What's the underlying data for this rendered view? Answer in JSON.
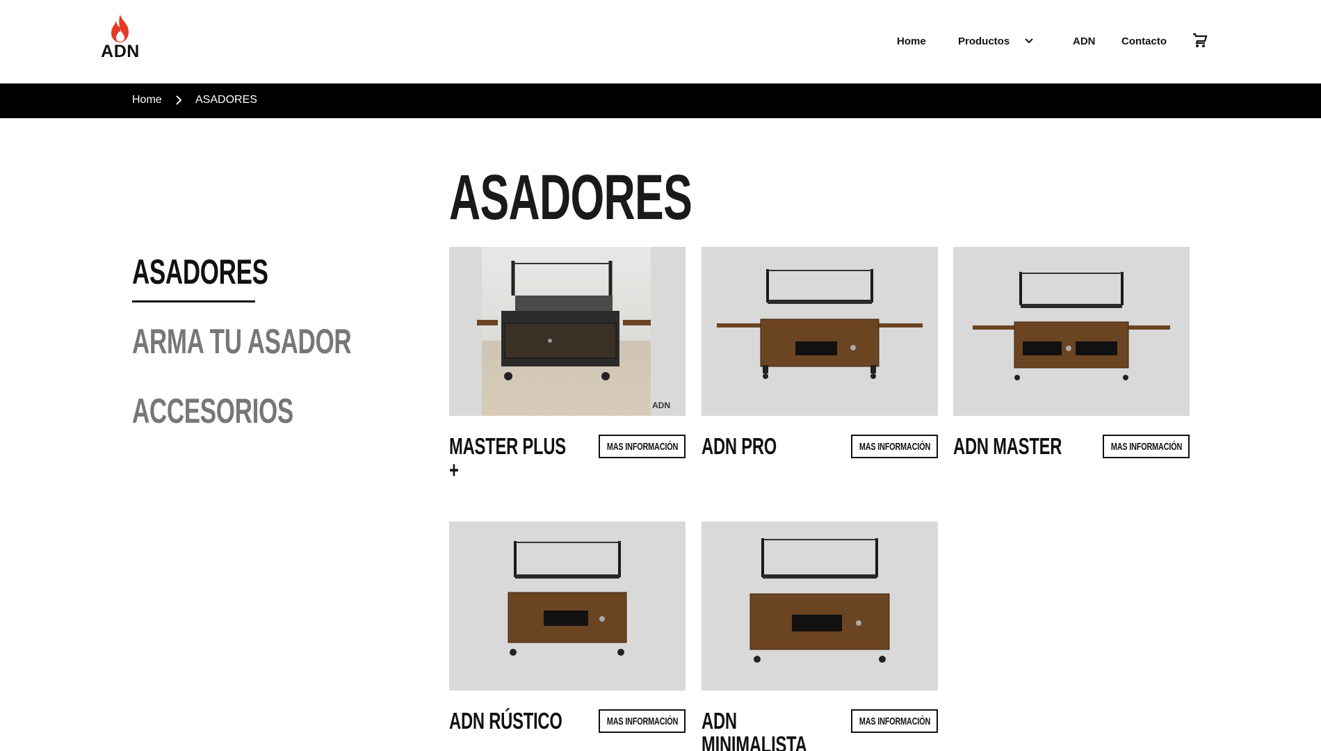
{
  "header": {
    "logo_text": "ADN",
    "nav": {
      "home": "Home",
      "productos": "Productos",
      "adn": "ADN",
      "contacto": "Contacto"
    }
  },
  "breadcrumb": {
    "home": "Home",
    "current": "ASADORES"
  },
  "sidebar": {
    "items": [
      {
        "label": "ASADORES",
        "active": true
      },
      {
        "label": "ARMA TU ASADOR",
        "active": false
      },
      {
        "label": "ACCESORIOS",
        "active": false
      }
    ]
  },
  "main": {
    "title": "ASADORES",
    "button_label": "MAS INFORMACIÓN",
    "products": [
      {
        "name": "MASTER PLUS +"
      },
      {
        "name": "ADN PRO"
      },
      {
        "name": "ADN MASTER"
      },
      {
        "name": "ADN RÚSTICO"
      },
      {
        "name": "ADN MINIMALISTA"
      }
    ]
  },
  "colors": {
    "brand_flame": "#e53a26",
    "breadcrumb_bg": "#000000",
    "card_bg": "#d9d9d9",
    "wood": "#6b4422"
  }
}
